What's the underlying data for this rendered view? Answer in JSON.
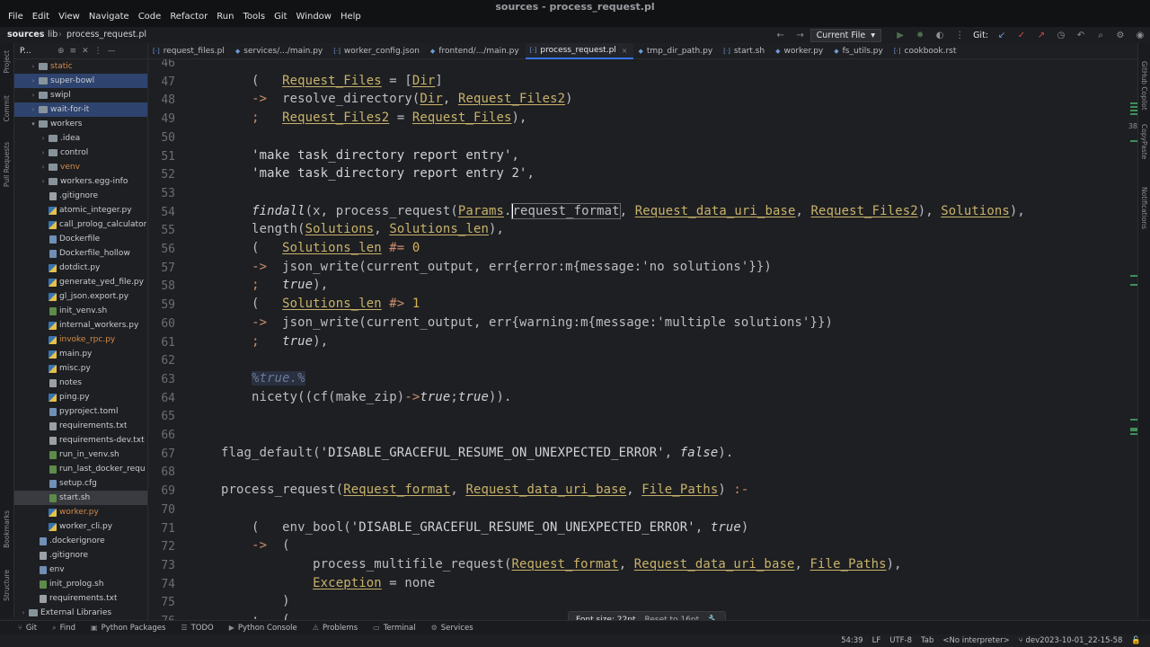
{
  "window": {
    "title": "sources - process_request.pl"
  },
  "menu": [
    "File",
    "Edit",
    "View",
    "Navigate",
    "Code",
    "Refactor",
    "Run",
    "Tools",
    "Git",
    "Window",
    "Help"
  ],
  "breadcrumb": {
    "project": "sources",
    "folder": "lib",
    "file": "process_request.pl"
  },
  "toolbar": {
    "run_config": "Current File",
    "git_label": "Git:"
  },
  "left_strip": {
    "project": "Project",
    "commit": "Commit",
    "pull_requests": "Pull Requests",
    "bookmarks": "Bookmarks",
    "structure": "Structure"
  },
  "right_strip": {
    "copilot": "GitHub Copilot",
    "copypaste": "CopyPaste",
    "notifications": "Notifications"
  },
  "project_panel": {
    "title": "P...",
    "items": [
      {
        "label": "static",
        "kind": "folder",
        "level": 1,
        "expanded": false,
        "state": "excluded"
      },
      {
        "label": "super-bowl",
        "kind": "folder",
        "level": 1,
        "expanded": false,
        "state": "selected"
      },
      {
        "label": "swipl",
        "kind": "folder",
        "level": 1,
        "expanded": false,
        "state": "normal"
      },
      {
        "label": "wait-for-it",
        "kind": "folder",
        "level": 1,
        "expanded": false,
        "state": "selected"
      },
      {
        "label": "workers",
        "kind": "folder",
        "level": 1,
        "expanded": true,
        "state": "normal"
      },
      {
        "label": ".idea",
        "kind": "folder",
        "level": 2,
        "expanded": false,
        "state": "normal"
      },
      {
        "label": "control",
        "kind": "folder",
        "level": 2,
        "expanded": false,
        "state": "normal"
      },
      {
        "label": "venv",
        "kind": "folder",
        "level": 2,
        "expanded": false,
        "state": "excluded"
      },
      {
        "label": "workers.egg-info",
        "kind": "folder",
        "level": 2,
        "expanded": false,
        "state": "normal"
      },
      {
        "label": ".gitignore",
        "kind": "txt",
        "level": 2,
        "state": "normal"
      },
      {
        "label": "atomic_integer.py",
        "kind": "py",
        "level": 2,
        "state": "normal"
      },
      {
        "label": "call_prolog_calculator",
        "kind": "py",
        "level": 2,
        "state": "normal"
      },
      {
        "label": "Dockerfile",
        "kind": "file",
        "level": 2,
        "state": "normal"
      },
      {
        "label": "Dockerfile_hollow",
        "kind": "file",
        "level": 2,
        "state": "normal"
      },
      {
        "label": "dotdict.py",
        "kind": "py",
        "level": 2,
        "state": "normal"
      },
      {
        "label": "generate_yed_file.py",
        "kind": "py",
        "level": 2,
        "state": "normal"
      },
      {
        "label": "gl_json.export.py",
        "kind": "py",
        "level": 2,
        "state": "normal"
      },
      {
        "label": "init_venv.sh",
        "kind": "sh",
        "level": 2,
        "state": "normal"
      },
      {
        "label": "internal_workers.py",
        "kind": "py",
        "level": 2,
        "state": "normal"
      },
      {
        "label": "invoke_rpc.py",
        "kind": "py",
        "level": 2,
        "state": "excluded"
      },
      {
        "label": "main.py",
        "kind": "py",
        "level": 2,
        "state": "normal"
      },
      {
        "label": "misc.py",
        "kind": "py",
        "level": 2,
        "state": "normal"
      },
      {
        "label": "notes",
        "kind": "txt",
        "level": 2,
        "state": "normal"
      },
      {
        "label": "ping.py",
        "kind": "py",
        "level": 2,
        "state": "normal"
      },
      {
        "label": "pyproject.toml",
        "kind": "file",
        "level": 2,
        "state": "normal"
      },
      {
        "label": "requirements.txt",
        "kind": "txt",
        "level": 2,
        "state": "normal"
      },
      {
        "label": "requirements-dev.txt",
        "kind": "txt",
        "level": 2,
        "state": "normal"
      },
      {
        "label": "run_in_venv.sh",
        "kind": "sh",
        "level": 2,
        "state": "normal"
      },
      {
        "label": "run_last_docker_requ",
        "kind": "sh",
        "level": 2,
        "state": "normal"
      },
      {
        "label": "setup.cfg",
        "kind": "file",
        "level": 2,
        "state": "normal"
      },
      {
        "label": "start.sh",
        "kind": "sh",
        "level": 2,
        "state": "current"
      },
      {
        "label": "worker.py",
        "kind": "py",
        "level": 2,
        "state": "excluded"
      },
      {
        "label": "worker_cli.py",
        "kind": "py",
        "level": 2,
        "state": "normal"
      },
      {
        "label": ".dockerignore",
        "kind": "file",
        "level": 1,
        "state": "normal"
      },
      {
        "label": ".gitignore",
        "kind": "txt",
        "level": 1,
        "state": "normal"
      },
      {
        "label": "env",
        "kind": "file",
        "level": 1,
        "state": "normal"
      },
      {
        "label": "init_prolog.sh",
        "kind": "sh",
        "level": 1,
        "state": "normal"
      },
      {
        "label": "requirements.txt",
        "kind": "txt",
        "level": 1,
        "state": "normal"
      },
      {
        "label": "External Libraries",
        "kind": "folder",
        "level": 0,
        "expanded": false,
        "state": "normal"
      }
    ]
  },
  "tabs": [
    {
      "label": "request_files.pl",
      "active": false
    },
    {
      "label": "services/.../main.py",
      "active": false
    },
    {
      "label": "worker_config.json",
      "active": false
    },
    {
      "label": "frontend/.../main.py",
      "active": false
    },
    {
      "label": "process_request.pl",
      "active": true
    },
    {
      "label": "tmp_dir_path.py",
      "active": false
    },
    {
      "label": "start.sh",
      "active": false
    },
    {
      "label": "worker.py",
      "active": false
    },
    {
      "label": "fs_utils.py",
      "active": false
    },
    {
      "label": "cookbook.rst",
      "active": false
    }
  ],
  "editor": {
    "inspection_count": "38",
    "lines": [
      {
        "n": "46",
        "html": ""
      },
      {
        "n": "47",
        "html": "    (   <span class='k-var'>Request_Files</span> = [<span class='k-var'>Dir</span>]"
      },
      {
        "n": "48",
        "html": "    <span class='k-op'>-&gt;</span>  resolve_directory(<span class='k-var'>Dir</span>, <span class='k-var'>Request_Files2</span>)"
      },
      {
        "n": "49",
        "html": "    <span class='k-op'>;</span>   <span class='k-var'>Request_Files2</span> = <span class='k-var'>Request_Files</span>),"
      },
      {
        "n": "50",
        "html": ""
      },
      {
        "n": "51",
        "html": "    <span class='k-str'>'make task_directory report entry'</span>,"
      },
      {
        "n": "52",
        "html": "    <span class='k-str'>'make task_directory report entry 2'</span>,"
      },
      {
        "n": "53",
        "html": ""
      },
      {
        "n": "54",
        "html": "    <span class='k-italic'>findall</span>(x, process_request(<span class='k-var'>Params</span>.<span class='caret boxed'>request_format</span>, <span class='k-var'>Request_data_uri_base</span>, <span class='k-var'>Request_Files2</span>), <span class='k-var'>Solutions</span>),"
      },
      {
        "n": "55",
        "html": "    length(<span class='k-var'>Solutions</span>, <span class='k-var'>Solutions_len</span>),"
      },
      {
        "n": "56",
        "html": "    (   <span class='k-var'>Solutions_len</span> <span class='k-op'>#=</span> <span class='k-num'>0</span>"
      },
      {
        "n": "57",
        "html": "    <span class='k-op'>-&gt;</span>  json_write(current_output, err{error:m{message:'no solutions'}})"
      },
      {
        "n": "58",
        "html": "    <span class='k-op'>;</span>   <span class='k-italic'>true</span>),"
      },
      {
        "n": "59",
        "html": "    (   <span class='k-var'>Solutions_len</span> <span class='k-op'>#&gt;</span> <span class='k-num'>1</span>"
      },
      {
        "n": "60",
        "html": "    <span class='k-op'>-&gt;</span>  json_write(current_output, err{warning:m{message:'multiple solutions'}})"
      },
      {
        "n": "61",
        "html": "    <span class='k-op'>;</span>   <span class='k-italic'>true</span>),"
      },
      {
        "n": "62",
        "html": ""
      },
      {
        "n": "63",
        "html": "    <span class='k-comment'>%true.%</span>"
      },
      {
        "n": "64",
        "html": "    nicety((cf(make_zip)<span class='k-op'>-&gt;</span><span class='k-italic'>true</span>;<span class='k-italic'>true</span>))."
      },
      {
        "n": "65",
        "html": ""
      },
      {
        "n": "66",
        "html": ""
      },
      {
        "n": "67",
        "html": "flag_default(<span class='k-str'>'DISABLE_GRACEFUL_RESUME_ON_UNEXPECTED_ERROR'</span>, <span class='k-italic'>false</span>)."
      },
      {
        "n": "68",
        "html": ""
      },
      {
        "n": "69",
        "html": "process_request(<span class='k-var'>Request_format</span>, <span class='k-var'>Request_data_uri_base</span>, <span class='k-var'>File_Paths</span>) <span class='k-op'>:-</span>"
      },
      {
        "n": "70",
        "html": ""
      },
      {
        "n": "71",
        "html": "    (   env_bool(<span class='k-str'>'DISABLE_GRACEFUL_RESUME_ON_UNEXPECTED_ERROR'</span>, <span class='k-italic'>true</span>)"
      },
      {
        "n": "72",
        "html": "    <span class='k-op'>-&gt;</span>  ("
      },
      {
        "n": "73",
        "html": "            process_multifile_request(<span class='k-var'>Request_format</span>, <span class='k-var'>Request_data_uri_base</span>, <span class='k-var'>File_Paths</span>),"
      },
      {
        "n": "74",
        "html": "            <span class='k-var'>Exception</span> = none"
      },
      {
        "n": "75",
        "html": "        )"
      },
      {
        "n": "76",
        "html": "    ;   ("
      }
    ]
  },
  "toast": {
    "font_size": "Font size: 22pt",
    "reset": "Reset to 16pt"
  },
  "tool_windows": [
    "Git",
    "Find",
    "Python Packages",
    "TODO",
    "Python Console",
    "Problems",
    "Terminal",
    "Services"
  ],
  "status": {
    "position": "54:39",
    "line_sep": "LF",
    "encoding": "UTF-8",
    "indent": "Tab",
    "interpreter": "<No interpreter>",
    "branch": "dev2023-10-01_22-15-58"
  }
}
